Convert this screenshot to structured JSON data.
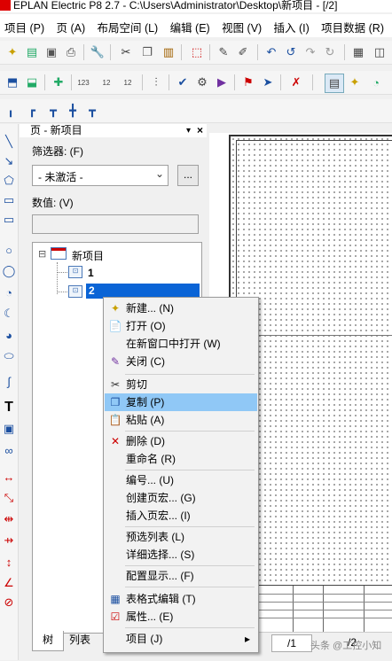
{
  "titlebar": {
    "text": "EPLAN Electric P8 2.7 - C:\\Users\\Administrator\\Desktop\\新项目 - [/2]"
  },
  "menu": [
    "项目 (P)",
    "页 (A)",
    "布局空间 (L)",
    "编辑 (E)",
    "视图 (V)",
    "插入 (I)",
    "项目数据 (R)",
    "查"
  ],
  "toolbar_row3_labels": {
    "a": "123",
    "b": "12",
    "c": "12"
  },
  "panel": {
    "title": "页 - 新项目",
    "pin_glyph": "▾",
    "close_glyph": "×",
    "filter_label": "筛选器: (F)",
    "filter_value": "- 未激活 -",
    "more_button": "...",
    "value_label": "数值: (V)",
    "value_input": ""
  },
  "tree": {
    "root": "新项目",
    "expander": "⊟",
    "pages": [
      "1",
      "2"
    ]
  },
  "context_menu": {
    "items": [
      {
        "label": "新建... (N)",
        "icon": "✦"
      },
      {
        "label": "打开 (O)",
        "icon": "📄"
      },
      {
        "label": "在新窗口中打开 (W)",
        "icon": ""
      },
      {
        "label": "关闭 (C)",
        "icon": "✎"
      },
      {
        "label": "剪切",
        "icon": "✂"
      },
      {
        "label": "复制 (P)",
        "icon": "❐"
      },
      {
        "label": "粘贴 (A)",
        "icon": "📋"
      },
      {
        "label": "删除 (D)",
        "icon": "✕"
      },
      {
        "label": "重命名 (R)",
        "icon": ""
      },
      {
        "label": "编号... (U)",
        "icon": ""
      },
      {
        "label": "创建页宏... (G)",
        "icon": ""
      },
      {
        "label": "插入页宏... (I)",
        "icon": ""
      },
      {
        "label": "预选列表 (L)",
        "icon": ""
      },
      {
        "label": "详细选择... (S)",
        "icon": ""
      },
      {
        "label": "配置显示... (F)",
        "icon": ""
      },
      {
        "label": "表格式编辑 (T)",
        "icon": "▦"
      },
      {
        "label": "属性... (E)",
        "icon": "☑"
      },
      {
        "label": "项目 (J)",
        "icon": "",
        "arrow": "▸"
      }
    ],
    "highlighted_index": 5
  },
  "bottom_tabs": {
    "tree": "树",
    "list": "列表",
    "page_slash1": "/1",
    "page_slash2": "/2"
  },
  "watermark": "头条 @工控小知",
  "colors": {
    "selection": "#0a64d6",
    "menu_highlight": "#90c8f6",
    "accent": "#d00000"
  }
}
